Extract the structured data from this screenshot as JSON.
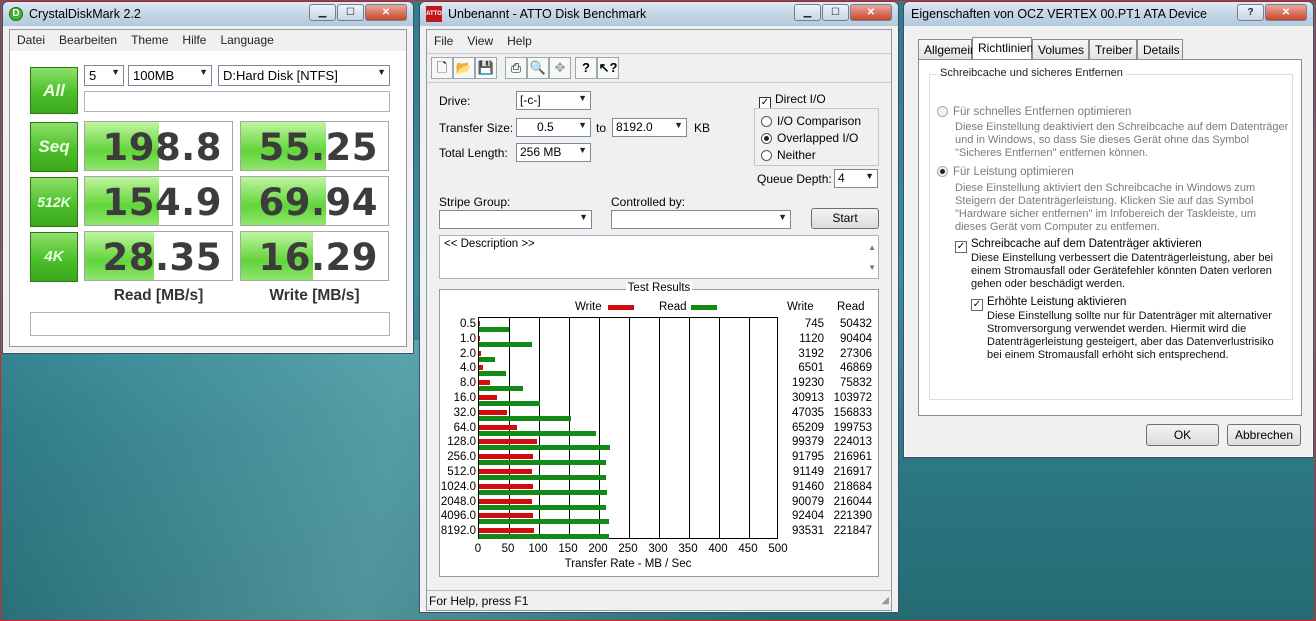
{
  "cdm": {
    "title": "CrystalDiskMark 2.2",
    "menu": [
      "Datei",
      "Bearbeiten",
      "Theme",
      "Hilfe",
      "Language"
    ],
    "runs": "5",
    "size": "100MB",
    "drive": "D:Hard Disk [NTFS]",
    "all_label": "All",
    "rows": [
      {
        "label": "Seq",
        "read": "198.8",
        "write": "55.25",
        "read_fill": 0.5,
        "write_fill": 0.58
      },
      {
        "label": "512K",
        "read": "154.9",
        "write": "69.94",
        "read_fill": 0.5,
        "write_fill": 0.58
      },
      {
        "label": "4K",
        "read": "28.35",
        "write": "16.29",
        "read_fill": 0.47,
        "write_fill": 0.49
      }
    ],
    "read_header": "Read [MB/s]",
    "write_header": "Write [MB/s]"
  },
  "atto": {
    "title": "Unbenannt - ATTO Disk Benchmark",
    "icon_text": "ATTO",
    "menu": [
      "File",
      "View",
      "Help"
    ],
    "drive_label": "Drive:",
    "drive_value": "[-c-]",
    "transfer_label": "Transfer Size:",
    "transfer_from": "0.5",
    "to_label": "to",
    "transfer_to": "8192.0",
    "kb_label": "KB",
    "total_label": "Total Length:",
    "total_value": "256 MB",
    "direct_io": "Direct I/O",
    "io_comparison": "I/O Comparison",
    "overlapped_io": "Overlapped I/O",
    "neither": "Neither",
    "queue_label": "Queue Depth:",
    "queue_value": "4",
    "stripe_label": "Stripe Group:",
    "controlled_label": "Controlled by:",
    "start_label": "Start",
    "description": "<< Description >>",
    "results_title": "Test Results",
    "legend_write": "Write",
    "legend_read": "Read",
    "col_write": "Write",
    "col_read": "Read",
    "xlabel": "Transfer Rate - MB / Sec",
    "xticks": [
      "0",
      "50",
      "100",
      "150",
      "200",
      "250",
      "300",
      "350",
      "400",
      "450",
      "500"
    ],
    "status": "For Help, press F1"
  },
  "chart_data": {
    "type": "bar",
    "xlabel": "Transfer Rate - MB / Sec",
    "xlim": [
      0,
      500
    ],
    "categories": [
      "0.5",
      "1.0",
      "2.0",
      "4.0",
      "8.0",
      "16.0",
      "32.0",
      "64.0",
      "128.0",
      "256.0",
      "512.0",
      "1024.0",
      "2048.0",
      "4096.0",
      "8192.0"
    ],
    "series": [
      {
        "name": "Write",
        "color": "#d20c0c",
        "values": [
          745,
          1120,
          3192,
          6501,
          19230,
          30913,
          47035,
          65209,
          99379,
          91795,
          91149,
          91460,
          90079,
          92404,
          93531
        ]
      },
      {
        "name": "Read",
        "color": "#118a18",
        "values": [
          50432,
          90404,
          27306,
          46869,
          75832,
          103972,
          156833,
          199753,
          224013,
          216961,
          216917,
          218684,
          216044,
          221390,
          221847
        ]
      }
    ]
  },
  "props": {
    "title": "Eigenschaften von OCZ     VERTEX      00.PT1 ATA Device",
    "tabs": [
      "Allgemein",
      "Richtlinien",
      "Volumes",
      "Treiber",
      "Details"
    ],
    "group_title": "Schreibcache und sicheres Entfernen",
    "opt1_label": "Für schnelles Entfernen optimieren",
    "opt1_desc": "Diese Einstellung deaktiviert den Schreibcache auf dem Datenträger und in Windows, so dass Sie dieses Gerät ohne das Symbol \"Sicheres Entfernen\" entfernen können.",
    "opt2_label": "Für Leistung optimieren",
    "opt2_desc": "Diese Einstellung aktiviert den Schreibcache in Windows zum Steigern der Datenträgerleistung. Klicken Sie auf das Symbol \"Hardware sicher entfernen\" im Infobereich der Taskleiste, um dieses Gerät vom Computer zu entfernen.",
    "chk1_label": "Schreibcache auf dem Datenträger aktivieren",
    "chk1_desc": "Diese Einstellung verbessert die Datenträgerleistung, aber bei einem Stromausfall oder Gerätefehler könnten Daten verloren gehen oder beschädigt werden.",
    "chk2_label": "Erhöhte Leistung aktivieren",
    "chk2_desc": "Diese Einstellung sollte nur für Datenträger mit alternativer Stromversorgung verwendet werden. Hiermit wird die Datenträgerleistung gesteigert, aber das Datenverlustrisiko bei einem Stromausfall erhöht sich entsprechend.",
    "ok_label": "OK",
    "cancel_label": "Abbrechen"
  }
}
